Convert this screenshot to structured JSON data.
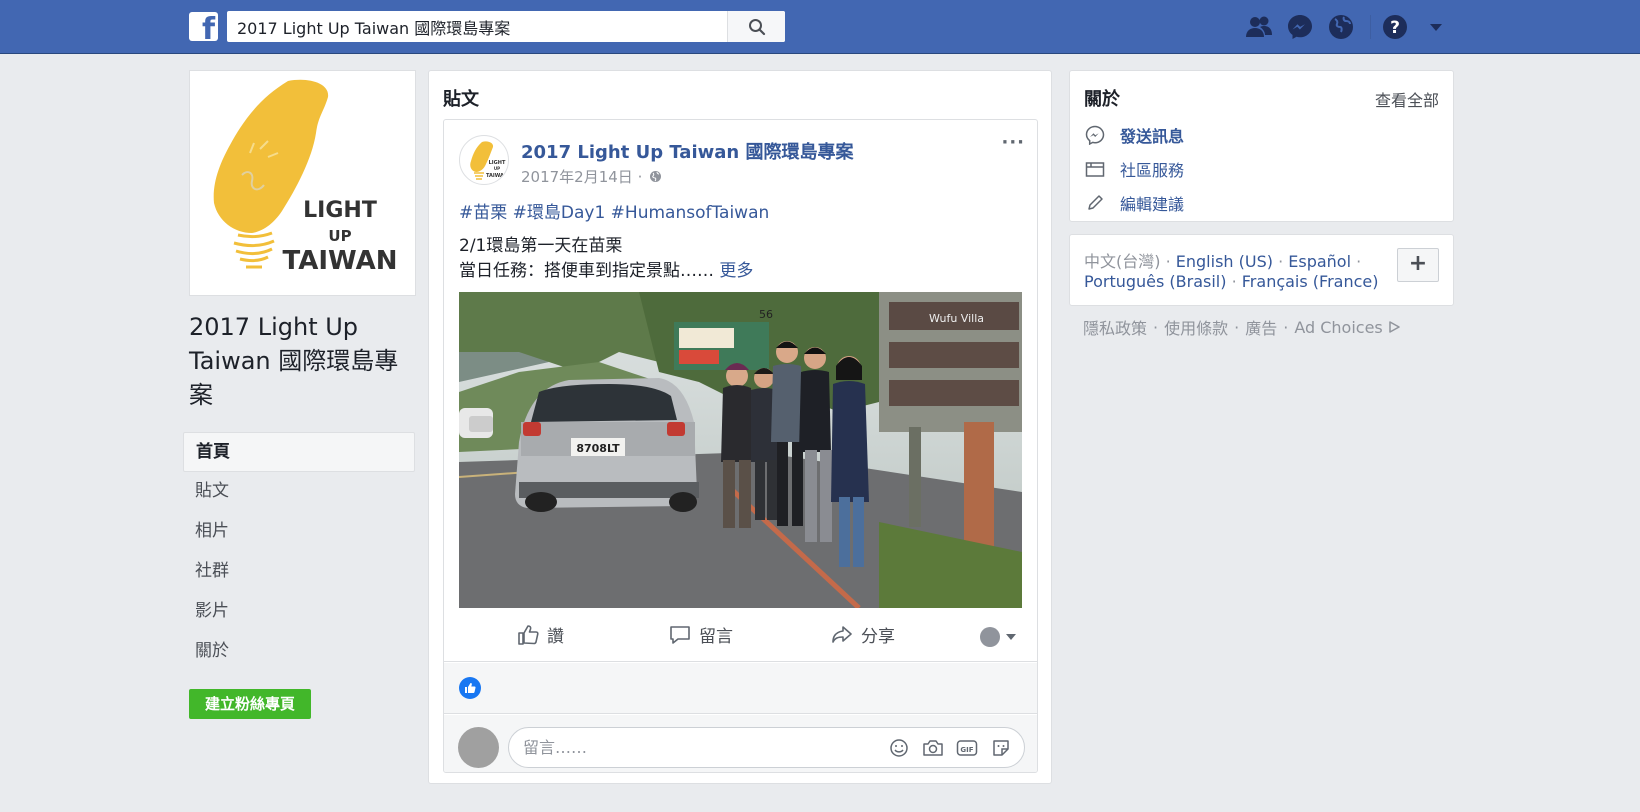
{
  "topbar": {
    "logo_letter": "f",
    "search_value": "2017 Light Up Taiwan 國際環島專案",
    "icons": [
      "friends-icon",
      "messenger-icon",
      "globe-icon",
      "help-icon",
      "caret-down-icon"
    ]
  },
  "left": {
    "logo_line1": "LIGHT",
    "logo_line2": "UP",
    "logo_line3": "TAIWAN",
    "page_name": "2017 Light Up Taiwan 國際環島專案",
    "nav": [
      {
        "label": "首頁",
        "active": true
      },
      {
        "label": "貼文"
      },
      {
        "label": "相片"
      },
      {
        "label": "社群"
      },
      {
        "label": "影片"
      },
      {
        "label": "關於"
      }
    ],
    "create_page_label": "建立粉絲專頁"
  },
  "center": {
    "section_title": "貼文",
    "post": {
      "author": "2017 Light Up Taiwan 國際環島專案",
      "date": "2017年2月14日 ·",
      "more": "···",
      "hashtags": "#苗栗 #環島Day1 #HumansofTaiwan",
      "line1": "2/1環島第一天在苗栗",
      "line2": "當日任務：搭便車到指定景點……",
      "more_link": "更多",
      "photo_plate": "8708LT",
      "photo_sign": "Wufu Villa",
      "photo_sign_num": "56",
      "actions": {
        "like": "讚",
        "comment": "留言",
        "share": "分享"
      },
      "comment_placeholder": "留言……"
    }
  },
  "right": {
    "about_title": "關於",
    "see_all": "查看全部",
    "rows": [
      {
        "label": "發送訊息",
        "icon": "messenger-icon"
      },
      {
        "label": "社區服務",
        "icon": "category-icon"
      },
      {
        "label": "編輯建議",
        "icon": "pencil-icon"
      }
    ],
    "languages": {
      "current": "中文(台灣)",
      "line1": [
        "English (US)",
        "Español"
      ],
      "line2": [
        "Português (Brasil)",
        "Français (France)"
      ],
      "add": "+"
    },
    "footer": [
      "隱私政策",
      "使用條款",
      "廣告",
      "Ad Choices"
    ]
  },
  "colors": {
    "brand": "#4267b2",
    "link": "#365899",
    "green": "#42b72a"
  }
}
